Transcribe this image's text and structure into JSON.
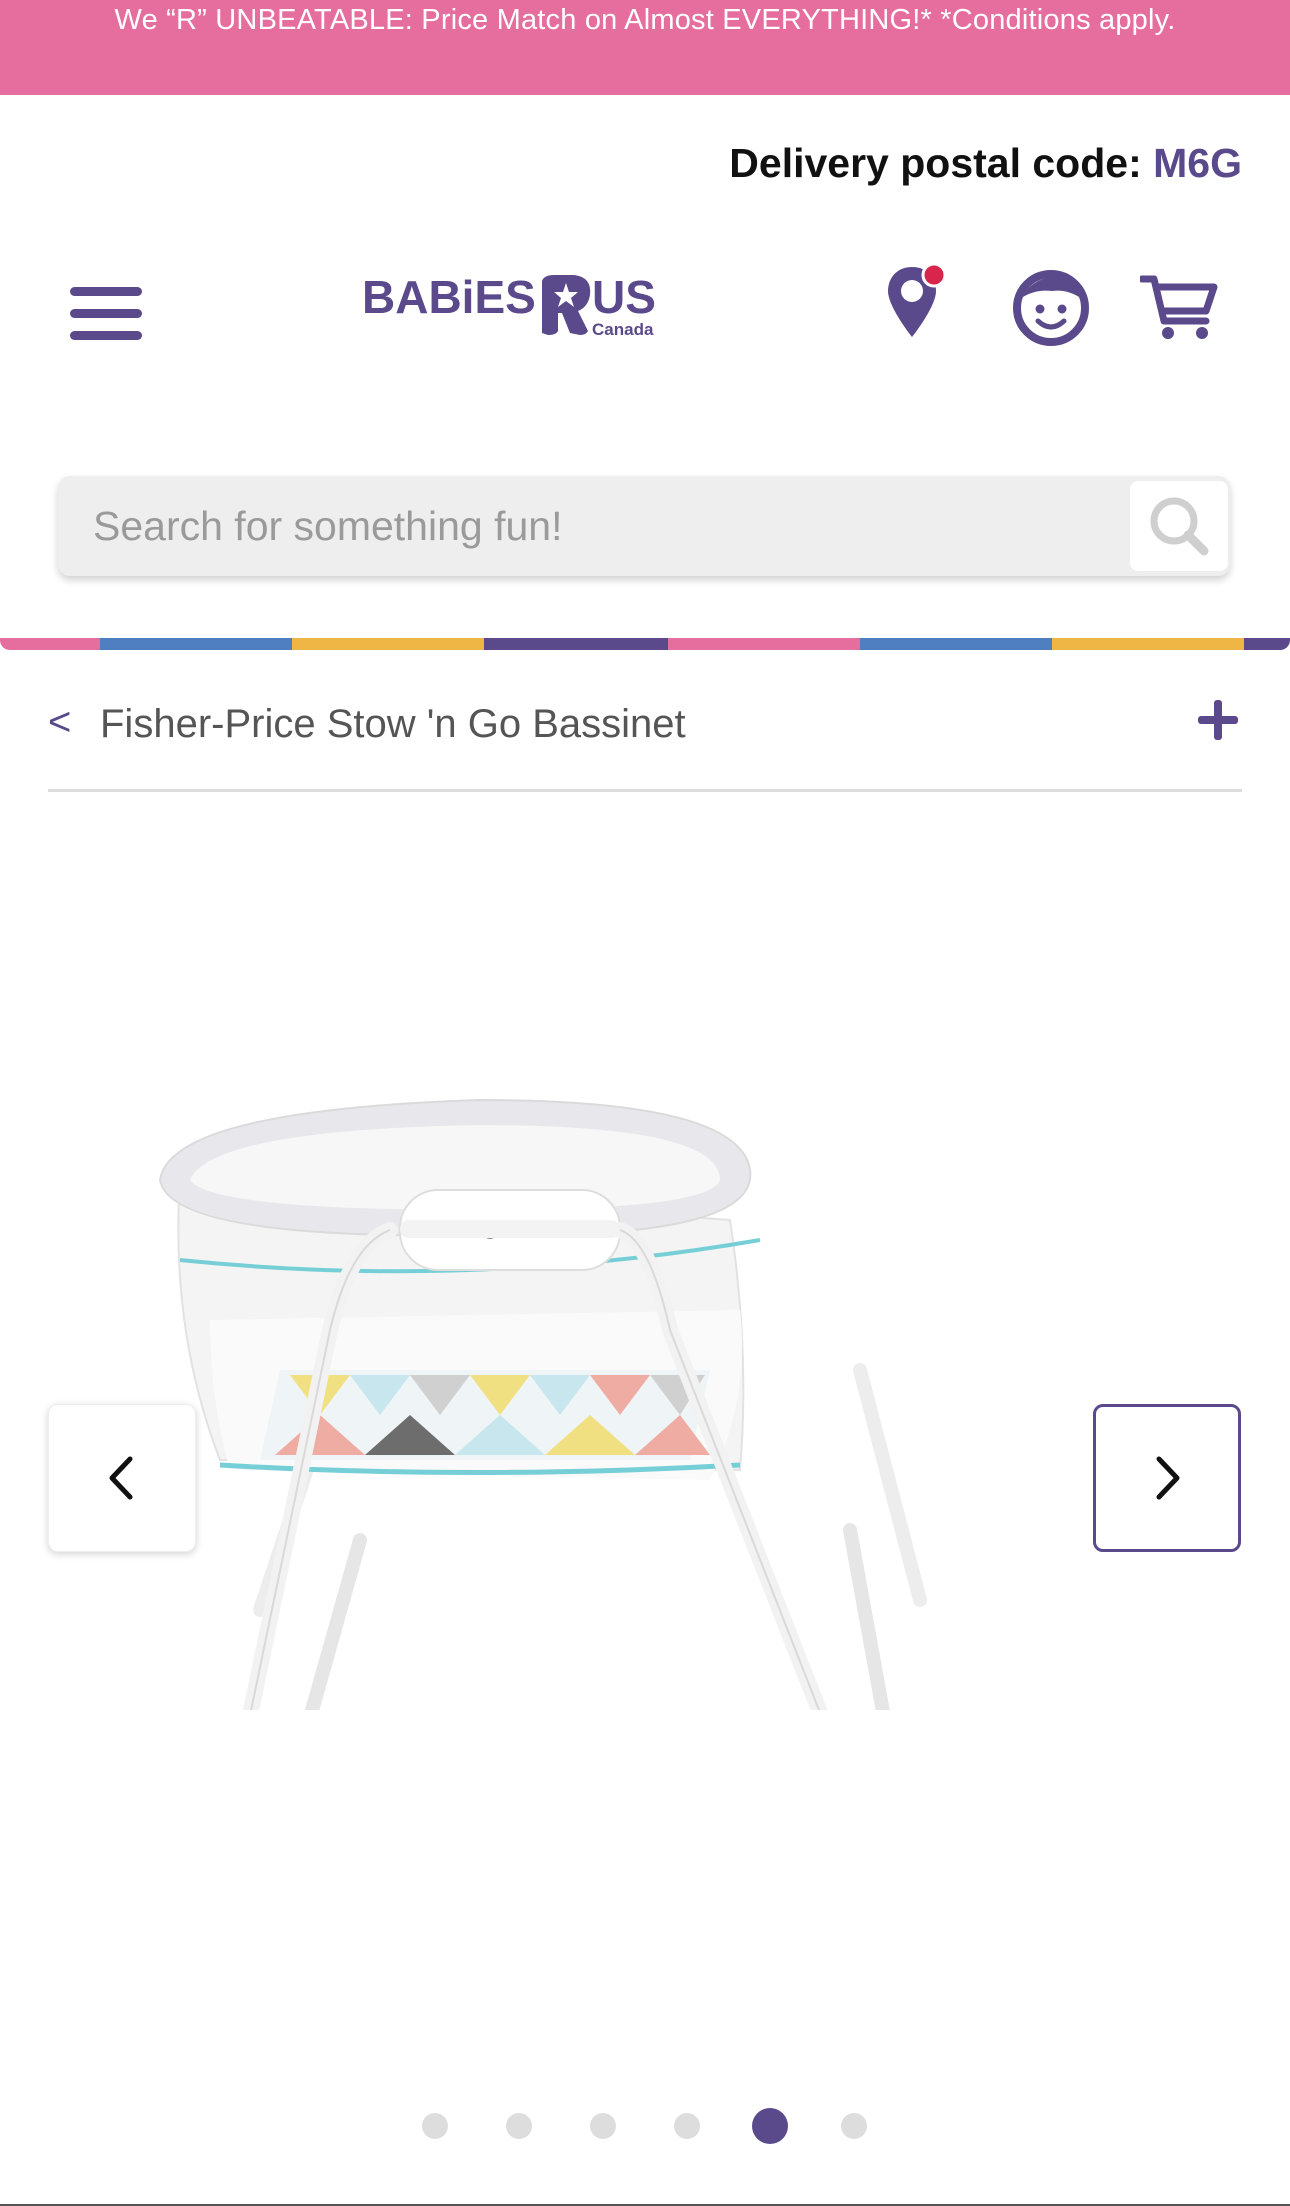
{
  "promo": {
    "text": "We “R” UNBEATABLE: Price Match on Almost EVERYTHING!*  *Conditions apply."
  },
  "delivery": {
    "label": "Delivery postal code:",
    "code": "M6G"
  },
  "header": {
    "logo_text": "BABiES",
    "logo_r": "R",
    "logo_us": "US",
    "logo_sub": "Canada",
    "icons": [
      "menu-icon",
      "map-pin-icon",
      "account-face-icon",
      "cart-icon"
    ]
  },
  "search": {
    "placeholder": "Search for something fun!"
  },
  "breadcrumb": {
    "back_symbol": "<",
    "title": "Fisher-Price Stow 'n Go Bassinet",
    "expand_symbol": "+"
  },
  "gallery": {
    "slide_count": 6,
    "active_index": 4
  },
  "colors": {
    "brand_purple": "#5b4a8b",
    "promo_pink": "#e56e9e",
    "notification_red": "#d9254b",
    "bar_stripes": [
      "#e56e9e",
      "#4f7fc1",
      "#efb646",
      "#5b4a8b",
      "#e56e9e",
      "#4f7fc1",
      "#efb646",
      "#5b4a8b"
    ]
  }
}
